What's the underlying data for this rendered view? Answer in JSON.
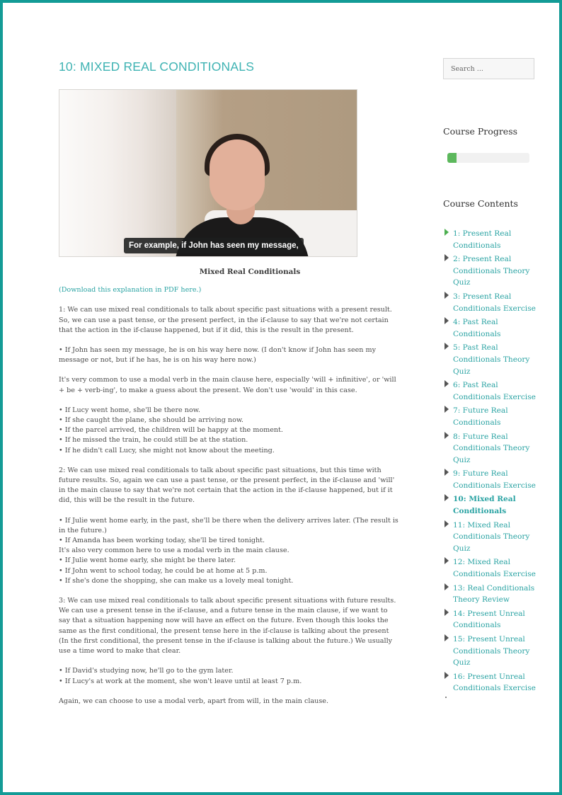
{
  "page": {
    "title": "10: MIXED REAL CONDITIONALS",
    "accent_color": "#139b96",
    "link_color": "#2aa3a3"
  },
  "video": {
    "caption": "For example, if John has seen my message,"
  },
  "content": {
    "heading": "Mixed Real Conditionals",
    "pdf_link": "(Download this explanation in PDF here.)",
    "section1": {
      "intro": "1: We can use mixed real conditionals to talk about specific past situations with a present result. So, we can use a past tense, or the present perfect, in the if-clause to say that we're not certain that the action in the if-clause happened, but if it did, this is the result in the present.",
      "example": "• If John has seen my message, he is on his way here now. (I don't know if John has seen my message or not, but if he has, he is on his way here now.)",
      "modal_note": "It's very common to use a modal verb in the main clause here, especially 'will + infinitive', or 'will + be + verb-ing', to make a guess about the present. We don't use 'would' in this case.",
      "bullets": [
        "• If Lucy went home, she'll be there now.",
        "• If she caught the plane, she should be arriving now.",
        "• If the parcel arrived, the children will be happy at the moment.",
        "• If he missed the train, he could still be at the station.",
        "• If he didn't call Lucy, she might not know about the meeting."
      ]
    },
    "section2": {
      "intro": "2: We can use mixed real conditionals to talk about specific past situations, but this time with future results. So, again we can use a past tense, or the present perfect, in the if-clause and 'will' in the main clause to say that we're not certain that the action in the if-clause happened, but if it did, this will be the result in the future.",
      "bullets": [
        "• If Julie went home early, in the past, she'll be there when the delivery arrives later. (The result is in the future.)",
        "• If Amanda has been working today, she'll be tired tonight.",
        "It's also very common here to use a modal verb in the main clause.",
        "• If Julie went home early, she might be there later.",
        "• If John went to school today, he could be at home at 5 p.m.",
        "• If she's done the shopping, she can make us a lovely meal tonight."
      ]
    },
    "section3": {
      "intro": "3: We can use mixed real conditionals to talk about specific present situations with future results. We can use a present tense in the if-clause, and a future tense in the main clause, if we want to say that a situation happening now will have an effect on the future. Even though this looks the same as the first conditional, the present tense here in the if-clause is talking about the present (In the first conditional, the present tense in the if-clause is talking about the future.) We usually use a time word to make that clear.",
      "bullets": [
        "• If David's studying now, he'll go to the gym later.",
        "• If Lucy's at work at the moment, she won't leave until at least 7 p.m."
      ],
      "closing": "Again, we can choose to use a modal verb, apart from will, in the main clause."
    }
  },
  "sidebar": {
    "search_placeholder": "Search ...",
    "progress_title": "Course Progress",
    "progress_percent": 11,
    "progress_color": "#5cb85c",
    "contents_title": "Course Contents",
    "lessons": [
      {
        "label": "1: Present Real Conditionals",
        "status": "done"
      },
      {
        "label": "2: Present Real Conditionals Theory Quiz",
        "status": "todo"
      },
      {
        "label": "3: Present Real Conditionals Exercise",
        "status": "todo"
      },
      {
        "label": "4: Past Real Conditionals",
        "status": "todo"
      },
      {
        "label": "5: Past Real Conditionals Theory Quiz",
        "status": "todo"
      },
      {
        "label": "6: Past Real Conditionals Exercise",
        "status": "todo"
      },
      {
        "label": "7: Future Real Conditionals",
        "status": "todo"
      },
      {
        "label": "8: Future Real Conditionals Theory Quiz",
        "status": "todo"
      },
      {
        "label": "9: Future Real Conditionals Exercise",
        "status": "todo"
      },
      {
        "label": "10: Mixed Real Conditionals",
        "status": "current"
      },
      {
        "label": "11: Mixed Real Conditionals Theory Quiz",
        "status": "todo"
      },
      {
        "label": "12: Mixed Real Conditionals Exercise",
        "status": "todo"
      },
      {
        "label": "13: Real Conditionals Theory Review",
        "status": "todo"
      },
      {
        "label": "14: Present Unreal Conditionals",
        "status": "todo"
      },
      {
        "label": "15: Present Unreal Conditionals Theory Quiz",
        "status": "todo"
      },
      {
        "label": "16: Present Unreal Conditionals Exercise",
        "status": "todo"
      }
    ]
  }
}
